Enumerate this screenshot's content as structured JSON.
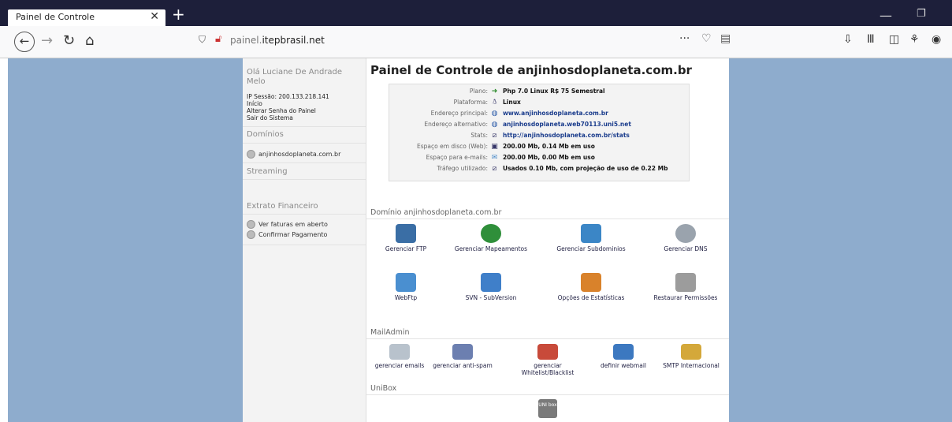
{
  "browser": {
    "tab_title": "Painel de Controle",
    "tab_close": "✕",
    "new_tab": "+",
    "url_plain": "painel.",
    "url_domain": "itepbrasil.net",
    "url_more": "···",
    "min": "—",
    "max": "❐"
  },
  "left": {
    "greeting": "Olá Luciane De Andrade Melo",
    "ip": "IP Sessão: 200.133.218.141",
    "links": [
      "Início",
      "Alterar Senha do Painel",
      "Sair do Sistema"
    ],
    "dominios_heading": "Domínios",
    "domain_item": "anjinhosdoplaneta.com.br",
    "streaming_heading": "Streaming",
    "extrato_heading": "Extrato Financeiro",
    "extrato_items": [
      "Ver faturas em aberto",
      "Confirmar Pagamento"
    ]
  },
  "main": {
    "title": "Painel de Controle de anjinhosdoplaneta.com.br",
    "info": [
      {
        "label": "Plano:",
        "icon": "arrow-icon",
        "value": "Php 7.0 Linux R$ 75 Semestral"
      },
      {
        "label": "Plataforma:",
        "icon": "linux-icon",
        "value": "Linux"
      },
      {
        "label": "Endereço principal:",
        "icon": "globe-icon",
        "value": "www.anjinhosdoplaneta.com.br"
      },
      {
        "label": "Endereço alternativo:",
        "icon": "globe-icon",
        "value": "anjinhosdoplaneta.web70113.uni5.net"
      },
      {
        "label": "Stats:",
        "icon": "stats-icon",
        "value": "http://anjinhosdoplaneta.com.br/stats"
      },
      {
        "label": "Espaço em disco (Web):",
        "icon": "disk-icon",
        "value": "200.00 Mb, 0.14 Mb em uso"
      },
      {
        "label": "Espaço para e-mails:",
        "icon": "mail-icon",
        "value": "200.00 Mb, 0.00 Mb em uso"
      },
      {
        "label": "Tráfego utilizado:",
        "icon": "traffic-icon",
        "value": "Usados 0.10 Mb, com projeção de uso de 0.22 Mb"
      }
    ],
    "domain_section": "Domínio anjinhosdoplaneta.com.br",
    "domain_items": [
      {
        "label": "Gerenciar FTP",
        "icon": "ftp-icon",
        "color": "#3a6ea5"
      },
      {
        "label": "Gerenciar Mapeamentos",
        "icon": "mapping-icon",
        "color": "#2f8f3a"
      },
      {
        "label": "Gerenciar Subdominios",
        "icon": "subdomain-icon",
        "color": "#3b86c6"
      },
      {
        "label": "Gerenciar DNS",
        "icon": "dns-icon",
        "color": "#9aa3ad"
      },
      {
        "label": "WebFtp",
        "icon": "webftp-icon",
        "color": "#4a8fd0"
      },
      {
        "label": "SVN - SubVersion",
        "icon": "svn-icon",
        "color": "#3f7fc9"
      },
      {
        "label": "Opções de Estatísticas",
        "icon": "stats-options-icon",
        "color": "#d9822b"
      },
      {
        "label": "Restaurar Permissões",
        "icon": "permissions-icon",
        "color": "#9c9c9c"
      }
    ],
    "mail_section": "MailAdmin",
    "mail_items": [
      {
        "label": "gerenciar emails",
        "icon": "envelope-icon",
        "color": "#b8c2cc"
      },
      {
        "label": "gerenciar anti-spam",
        "icon": "antispam-icon",
        "color": "#6c7fb0"
      },
      {
        "label": "gerenciar Whitelist/Blacklist",
        "icon": "whitelist-icon",
        "color": "#c84a3a"
      },
      {
        "label": "definir webmail",
        "icon": "webmail-icon",
        "color": "#3c78c0"
      },
      {
        "label": "SMTP Internacional",
        "icon": "smtp-icon",
        "color": "#d4a83a"
      }
    ],
    "unibox_section": "UniBox",
    "unibox_icon_text": "UNI box"
  }
}
